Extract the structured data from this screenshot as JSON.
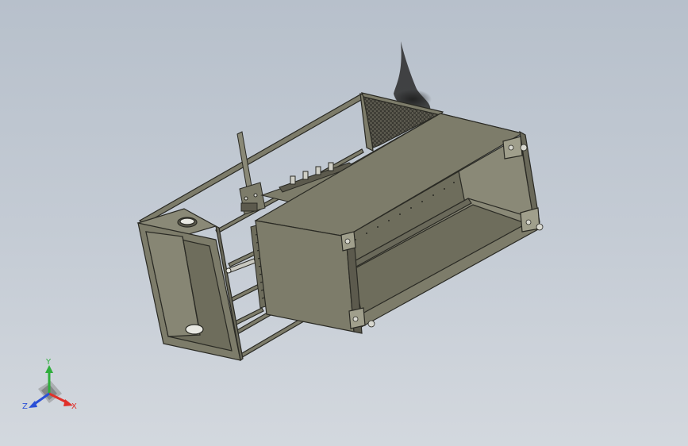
{
  "triad": {
    "x_label": "X",
    "y_label": "Y",
    "z_label": "Z",
    "x_color": "#e0302a",
    "y_color": "#2fae3c",
    "z_color": "#2a4fd6"
  },
  "colors": {
    "background_top": "#b7c0cb",
    "background_bottom": "#d3d8de",
    "model_face": "#7d7c6a",
    "model_face_light": "#8a8977",
    "model_edge": "#2a2a24"
  }
}
